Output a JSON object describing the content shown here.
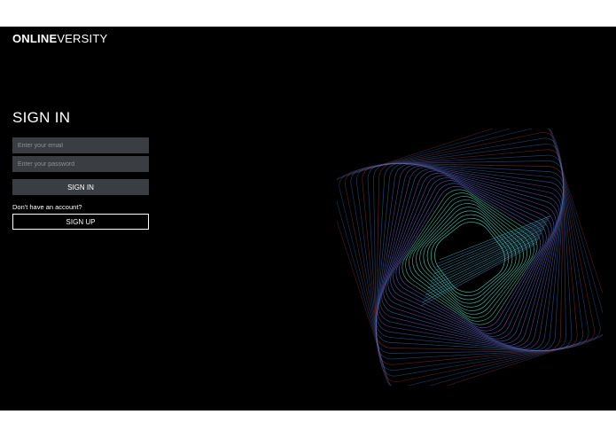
{
  "header": {
    "logo_bold": "ONLINE",
    "logo_light": "VERSITY"
  },
  "signin": {
    "title": "SIGN IN",
    "email_placeholder": "Enter your email",
    "password_placeholder": "Enter your password",
    "signin_label": "SIGN IN",
    "no_account_text": "Don't have an account?",
    "signup_label": "SIGN UP"
  },
  "art": {
    "icon": "spiral-lines-artwork",
    "colors": {
      "blue": "#3f7fd6",
      "teal": "#3fd0b6",
      "red": "#c0405a",
      "purple": "#8a5ad0"
    }
  }
}
